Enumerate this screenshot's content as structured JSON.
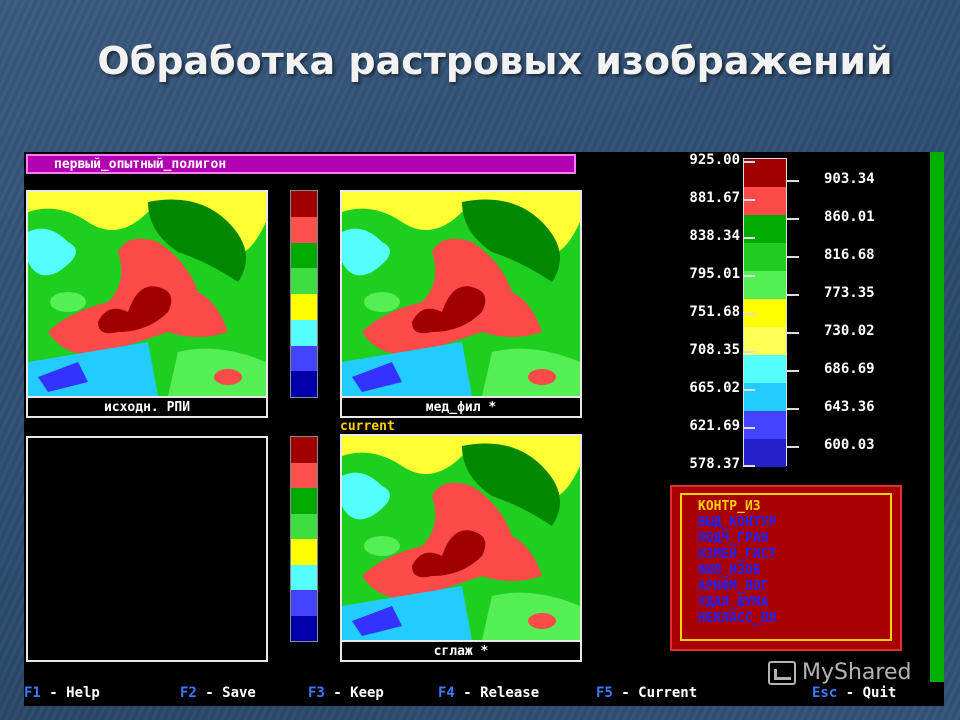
{
  "slide": {
    "title": "Обработка растровых изображений"
  },
  "app": {
    "title_bar": "первый_опытный_полигон",
    "panels": {
      "source": "исходн. РПИ",
      "median": "мед_фил *",
      "current_tag": "current",
      "smooth": "сглаж *"
    },
    "scale_left": [
      "925.00",
      "881.67",
      "838.34",
      "795.01",
      "751.68",
      "708.35",
      "665.02",
      "621.69",
      "578.37"
    ],
    "scale_right": [
      "903.34",
      "860.01",
      "816.68",
      "773.35",
      "730.02",
      "686.69",
      "643.36",
      "600.03"
    ],
    "palette": [
      "#a00000",
      "#ff4a4a",
      "#00aa00",
      "#22cc22",
      "#55ee55",
      "#ffff00",
      "#ffff55",
      "#55ffff",
      "#22ccff",
      "#4444ff",
      "#2222cc"
    ],
    "mini_palette": [
      "#a00000",
      "#ff5050",
      "#00aa00",
      "#40dd40",
      "#ffff00",
      "#55ffff",
      "#4444ff",
      "#0000aa"
    ],
    "menu": [
      {
        "label": "КОНТР_ИЗ",
        "active": true
      },
      {
        "label": "ВЫД_КОНТУР",
        "active": false
      },
      {
        "label": "ПОДЧ_ГРАН",
        "active": false
      },
      {
        "label": "ИЗМЕН_ГИСТ",
        "active": false
      },
      {
        "label": "ФИЛ_ИЗОБ",
        "active": false
      },
      {
        "label": "АРИФМ_ЛОГ",
        "active": false
      },
      {
        "label": "УДАЛ_ШУМА",
        "active": false
      },
      {
        "label": "НЕКЛАСС_ПЛ",
        "active": false
      }
    ],
    "fkeys": [
      {
        "key": "F1",
        "label": "Help"
      },
      {
        "key": "F2",
        "label": "Save"
      },
      {
        "key": "F3",
        "label": "Keep"
      },
      {
        "key": "F4",
        "label": "Release"
      },
      {
        "key": "F5",
        "label": "Current"
      },
      {
        "key": "Esc",
        "label": "Quit"
      }
    ]
  },
  "watermark": "MyShared"
}
